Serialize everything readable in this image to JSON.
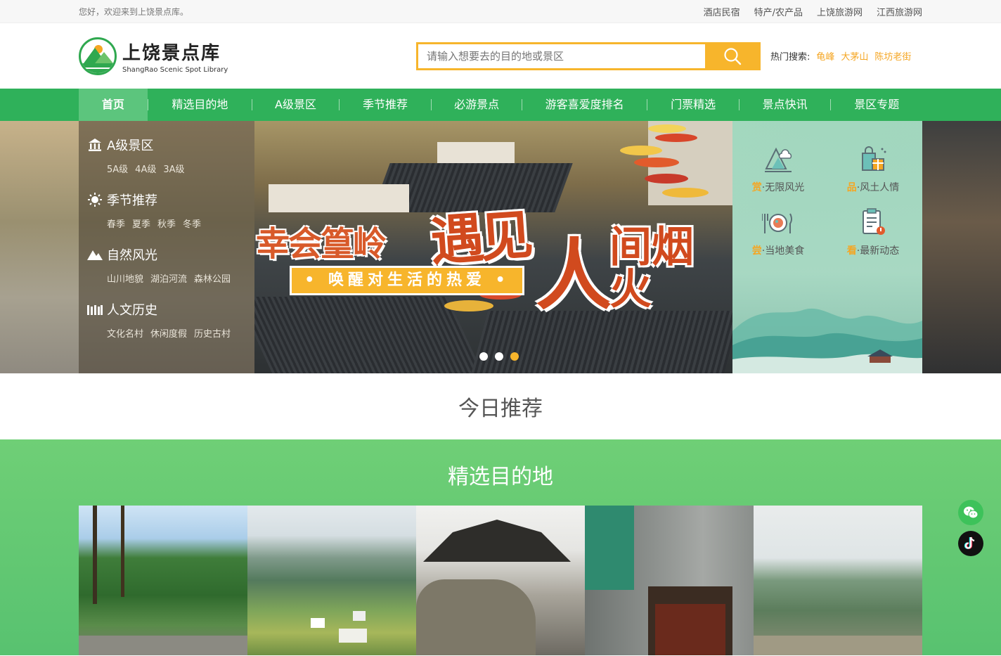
{
  "topbar": {
    "welcome": "您好，欢迎来到上饶景点库。",
    "links": [
      "酒店民宿",
      "特产/农产品",
      "上饶旅游网",
      "江西旅游网"
    ]
  },
  "header": {
    "logo_cn": "上饶景点库",
    "logo_en": "ShangRao Scenic Spot Library",
    "search_placeholder": "请输入想要去的目的地或景区",
    "hot_label": "热门搜索:",
    "hot_terms": [
      "龟峰",
      "大茅山",
      "陈坊老街"
    ]
  },
  "nav": {
    "items": [
      "首页",
      "精选目的地",
      "A级景区",
      "季节推荐",
      "必游景点",
      "游客喜爱度排名",
      "门票精选",
      "景点快讯",
      "景区专题"
    ],
    "active_index": 0
  },
  "categories": [
    {
      "title": "A级景区",
      "icon": "building-icon",
      "links": [
        "5A级",
        "4A级",
        "3A级"
      ]
    },
    {
      "title": "季节推荐",
      "icon": "sun-icon",
      "links": [
        "春季",
        "夏季",
        "秋季",
        "冬季"
      ]
    },
    {
      "title": "自然风光",
      "icon": "mountain-icon",
      "links": [
        "山川地貌",
        "湖泊河流",
        "森林公园"
      ]
    },
    {
      "title": "人文历史",
      "icon": "columns-icon",
      "links": [
        "文化名村",
        "休闲度假",
        "历史古村"
      ]
    }
  ],
  "banner": {
    "title_small": "幸会篁岭",
    "title_big_1": "遇见",
    "title_big_2": "人",
    "title_big_3": "间烟火",
    "subtitle": "• 唤醒对生活的热爱 •",
    "slide_count": 3,
    "active_slide": 3
  },
  "features": [
    {
      "key": "赏",
      "label": "·无限风光",
      "icon": "landscape-icon"
    },
    {
      "key": "品",
      "label": "·风土人情",
      "icon": "shopping-bag-icon"
    },
    {
      "key": "尝",
      "label": "·当地美食",
      "icon": "dining-icon"
    },
    {
      "key": "看",
      "label": "·最新动态",
      "icon": "news-clipboard-icon"
    }
  ],
  "sections": {
    "today_title": "今日推荐",
    "featured_title": "精选目的地"
  },
  "colors": {
    "primary_green": "#2fb15a",
    "accent_orange": "#f7b52c",
    "featured_bg": "#6fcf76"
  },
  "social": [
    "wechat-icon",
    "douyin-icon"
  ]
}
